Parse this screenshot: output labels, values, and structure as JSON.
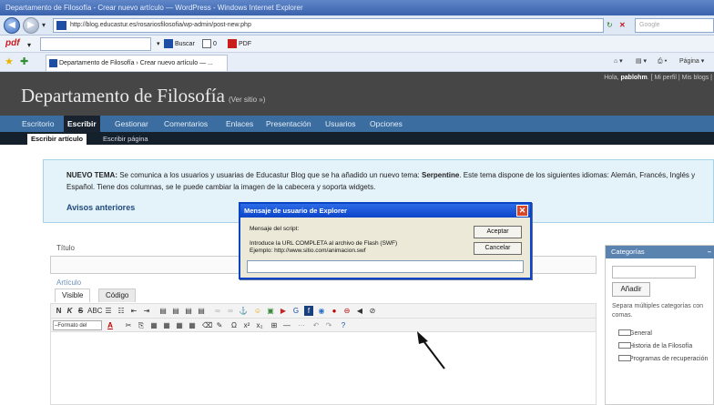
{
  "browser": {
    "window_title": "Departamento de Filosofía - Crear nuevo artículo — WordPress - Windows Internet Explorer",
    "address_url": "http://blog.educastur.es/rosariosfilosofia/wp-admin/post-new.php",
    "search_placeholder": "Google",
    "toolbar": {
      "pdf_label": "pdf",
      "buscar_label": "Buscar",
      "count_label": "0",
      "pdf_btn_label": "PDF"
    },
    "tab_title": "Departamento de Filosofía › Crear nuevo artículo — ...",
    "page_menu_label": "Página"
  },
  "wp": {
    "site_title": "Departamento de Filosofía",
    "ver_sitio": "(Ver sitio »)",
    "user_greeting": "Hola,",
    "user_name": "pablohm",
    "user_links": ". [ Mi perfil | Mis blogs | ",
    "menu": [
      "Escritorio",
      "Escribir",
      "Gestionar",
      "Comentarios",
      "Enlaces",
      "Presentación",
      "Usuarios",
      "Opciones"
    ],
    "submenu": [
      "Escribir artículo",
      "Escribir página"
    ],
    "notice": {
      "lead": "NUEVO TEMA:",
      "text": " Se comunica a los usuarios y usuarias de Educastur Blog que se ha añadido un nuevo tema: ",
      "theme": "Serpentine",
      "text2": ". Este tema dispone de los siguientes idiomas: Alemán, Francés, Inglés y Español. Tiene dos columnas, se le puede cambiar la imagen de la cabecera y soporta widgets.",
      "link": "Avisos anteriores"
    },
    "titulo_label": "Título",
    "articulo_label": "Artículo",
    "editor_tabs": [
      "Visible",
      "Código"
    ],
    "format_select": "–Formato del texto–",
    "sidebar": {
      "heading": "Categorías",
      "add_button": "Añadir",
      "note": "Separa múltiples categorías con comas.",
      "categories": [
        "General",
        "Historia de la Filosofía",
        "Programas de recuperación"
      ]
    }
  },
  "dialog": {
    "title": "Mensaje de usuario de Explorer",
    "label": "Mensaje del script:",
    "message_line1": "Introduce la URL COMPLETA al archivo de Flash (SWF)",
    "message_line2": "Ejemplo: http://www.sitio.com/animacion.swf",
    "accept": "Aceptar",
    "cancel": "Cancelar"
  },
  "colors": {
    "wp_header": "#464646",
    "wp_menu": "#3b6da0",
    "dialog_titlebar": "#0d45c8",
    "notice_bg": "#e4f2fa"
  }
}
